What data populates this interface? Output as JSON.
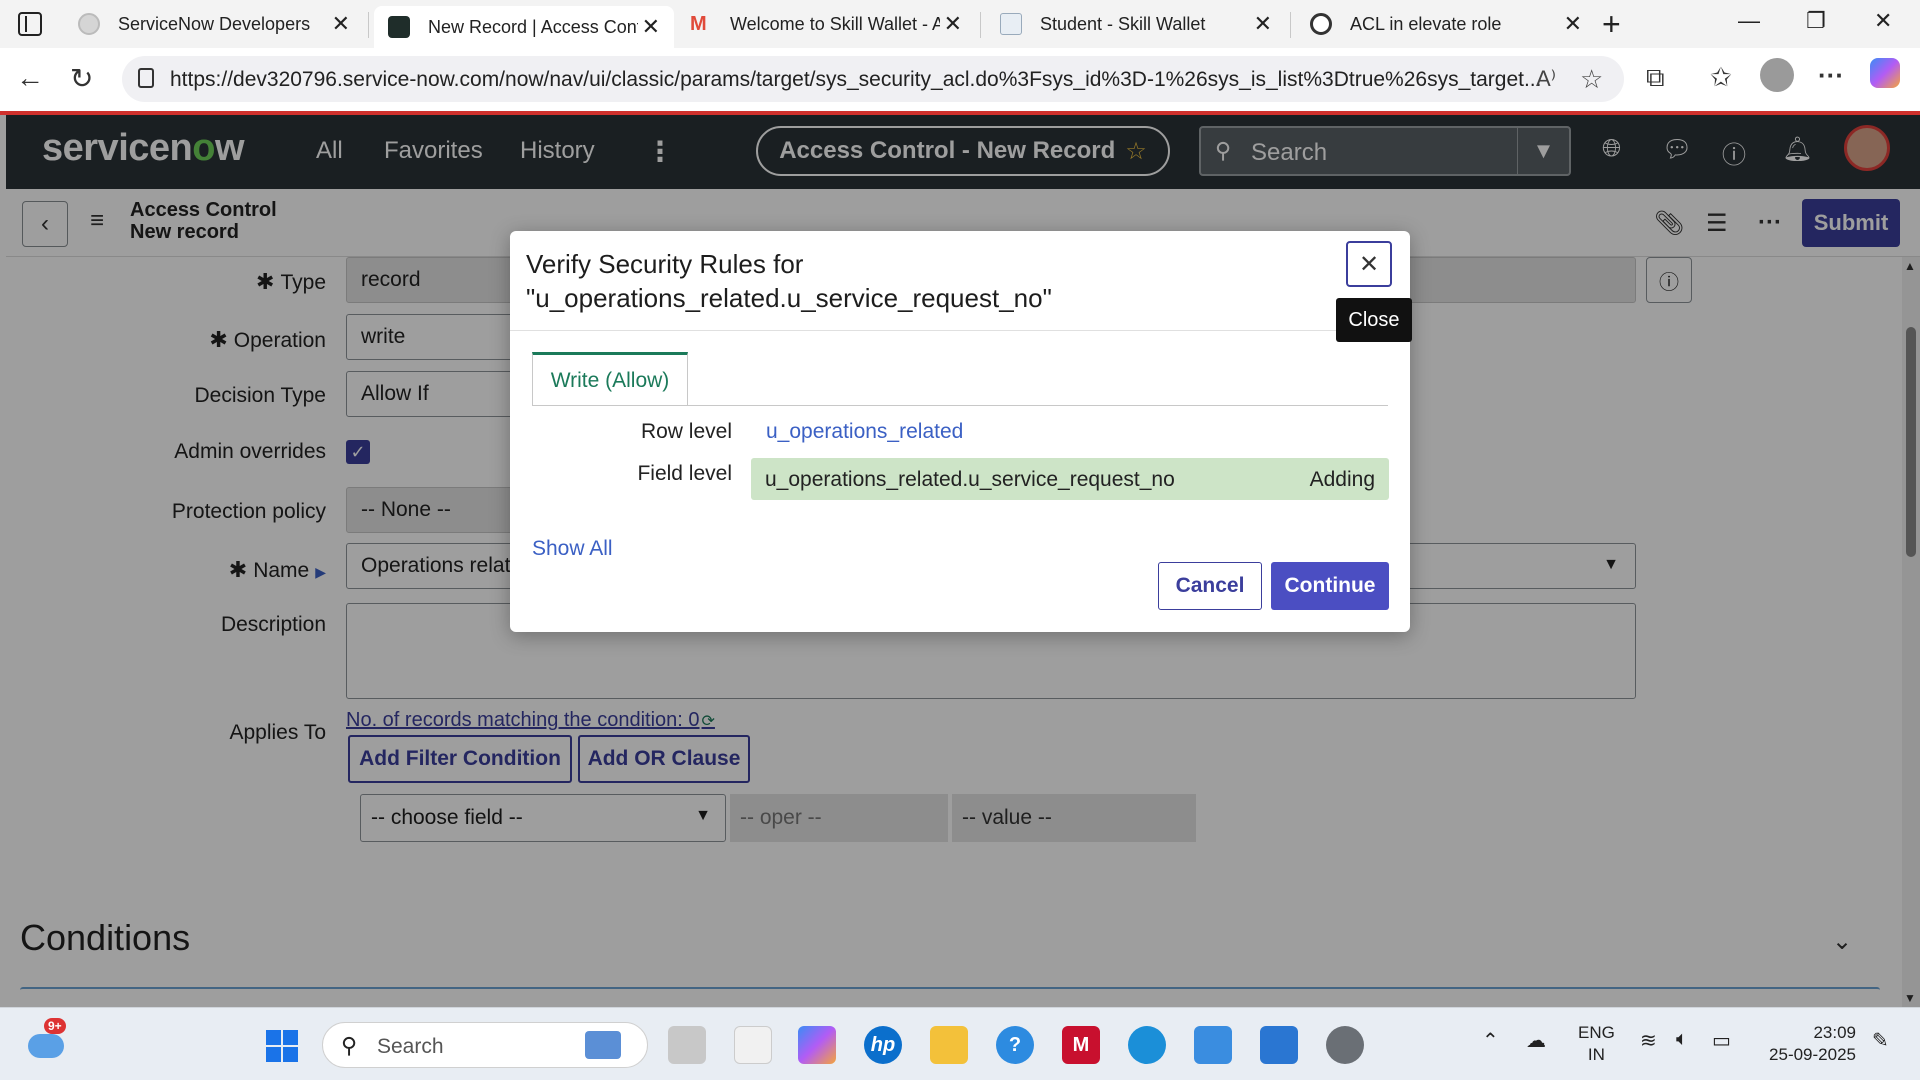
{
  "browser": {
    "tabs": [
      {
        "title": "ServiceNow Developers",
        "favicon_color": "#c7c7c7"
      },
      {
        "title": "New Record | Access Contr",
        "favicon_color": "#1f2d2a"
      },
      {
        "title": "Welcome to Skill Wallet - A",
        "favicon_color": "#e04a3a"
      },
      {
        "title": "Student - Skill Wallet",
        "favicon_color": "#9ab"
      },
      {
        "title": "ACL in elevate role",
        "favicon_color": "#333"
      }
    ],
    "url": "https://dev320796.service-now.com/now/nav/ui/classic/params/target/sys_security_acl.do%3Fsys_id%3D-1%26sys_is_list%3Dtrue%26sys_target..."
  },
  "sn_header": {
    "logo_pre": "servicen",
    "logo_o": "o",
    "logo_post": "w",
    "nav": [
      "All",
      "Favorites",
      "History"
    ],
    "context_title": "Access Control - New Record",
    "search_placeholder": "Search"
  },
  "form_toolbar": {
    "title_line1": "Access Control",
    "title_line2": "New record",
    "submit_label": "Submit"
  },
  "form": {
    "type_label": "Type",
    "type_value": "record",
    "operation_label": "Operation",
    "operation_value": "write",
    "decision_type_label": "Decision Type",
    "decision_type_value": "Allow If",
    "admin_overrides_label": "Admin overrides",
    "protection_policy_label": "Protection policy",
    "protection_policy_value": "-- None --",
    "name_label": "Name",
    "name_value": "Operations relat",
    "description_label": "Description",
    "applies_to_label": "Applies To",
    "records_matching": "No. of records matching the condition: 0",
    "add_filter_label": "Add Filter Condition",
    "add_or_label": "Add OR Clause",
    "choose_field": "-- choose field --",
    "oper": "-- oper --",
    "value": "-- value --",
    "conditions_heading": "Conditions"
  },
  "modal": {
    "title": "Verify Security Rules for \"u_operations_related.u_service_request_no\"",
    "close_tooltip": "Close",
    "tab_label": "Write (Allow)",
    "row_level_label": "Row level",
    "row_level_value": "u_operations_related",
    "field_level_label": "Field level",
    "field_level_value": "u_operations_related.u_service_request_no",
    "field_level_status": "Adding",
    "show_all": "Show All",
    "cancel_label": "Cancel",
    "continue_label": "Continue"
  },
  "taskbar": {
    "weather_badge": "9+",
    "search_placeholder": "Search",
    "lang_line1": "ENG",
    "lang_line2": "IN",
    "time": "23:09",
    "date": "25-09-2025"
  }
}
